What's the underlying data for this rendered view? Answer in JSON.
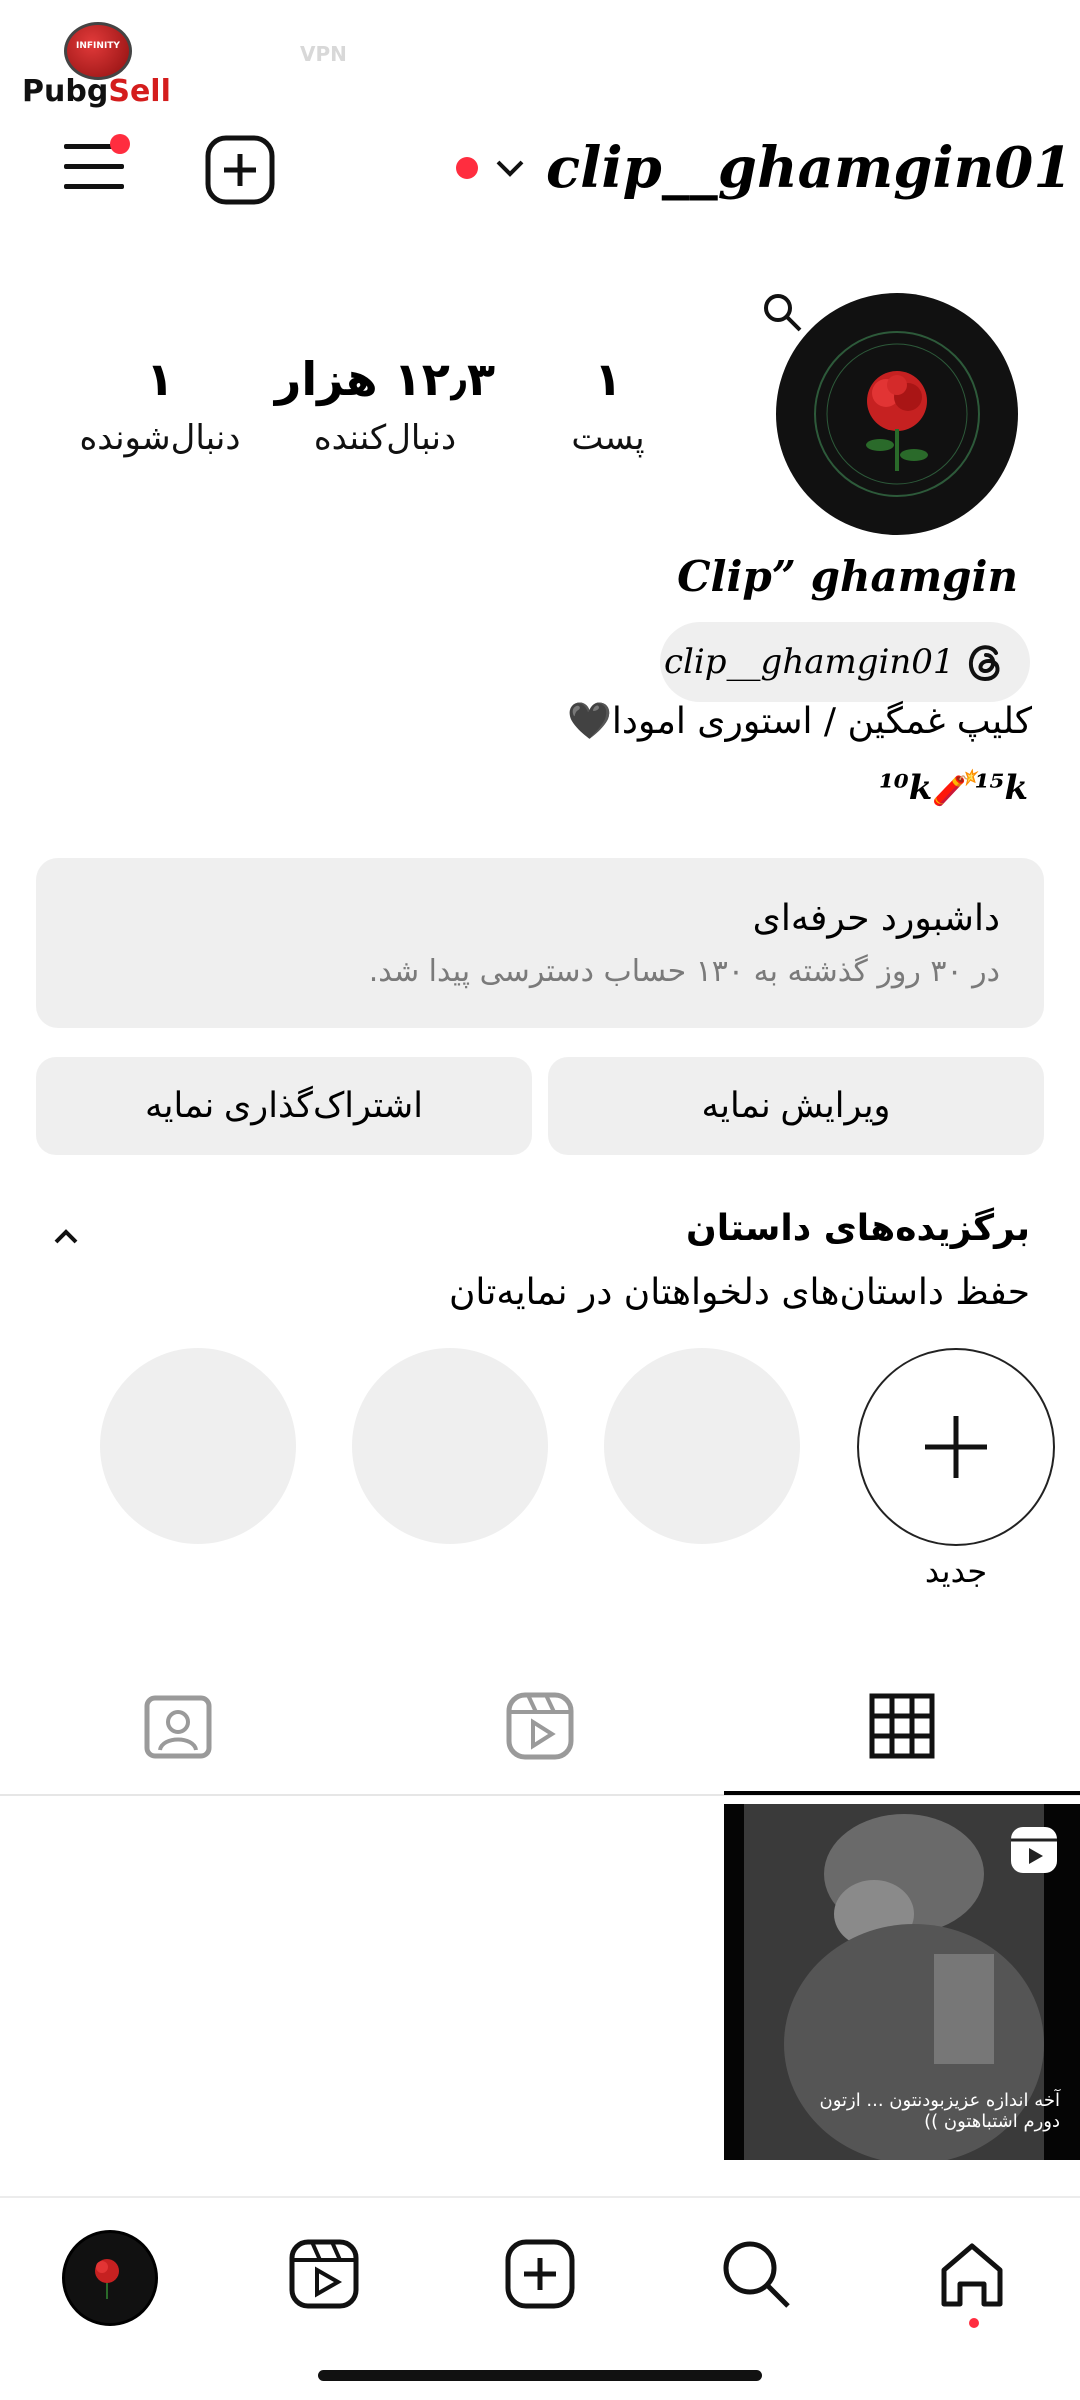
{
  "watermark": {
    "badge_text": "INFINITY",
    "logo_text": "PubgSell"
  },
  "status_bar": {
    "vpn_label": "VPN"
  },
  "header": {
    "username": "clip__ghamgin01"
  },
  "profile": {
    "display_name": "Clip” ghamgin",
    "threads_handle": "clip__ghamgin01",
    "bio_line1": "کلیپ غمگین / استوری امودا🖤",
    "bio_line2": "¹⁰k🧨¹⁵k"
  },
  "stats": {
    "posts": {
      "value": "۱",
      "label": "پست"
    },
    "followers": {
      "value": "۱۲٫۳ هزار",
      "label": "دنبال‌کننده"
    },
    "following": {
      "value": "۱",
      "label": "دنبال‌شونده"
    }
  },
  "dashboard": {
    "title": "داشبورد حرفه‌ای",
    "subtitle": "در ۳۰ روز گذشته به ۱۳۰ حساب دسترسی پیدا شد."
  },
  "buttons": {
    "edit_profile": "ویرایش نمایه",
    "share_profile": "اشتراک‌گذاری نمایه"
  },
  "highlights": {
    "title": "برگزیده‌های داستان",
    "subtitle": "حفظ داستان‌های دلخواهتان در نمایه‌تان",
    "new_label": "جدید"
  },
  "post": {
    "caption": "آخه اندازه عزیزبودنتون ... ازتون دورم اشتباهتون ))"
  },
  "colors": {
    "accent_red": "#ff2d3f",
    "pill_bg": "#efefef",
    "text_secondary": "#7a7a7a"
  },
  "icons": [
    "menu-icon",
    "add-post-icon",
    "chevron-down-icon",
    "search-icon",
    "threads-icon",
    "chevron-up-icon",
    "plus-icon",
    "grid-icon",
    "reels-icon",
    "tagged-icon",
    "home-icon",
    "create-icon"
  ]
}
